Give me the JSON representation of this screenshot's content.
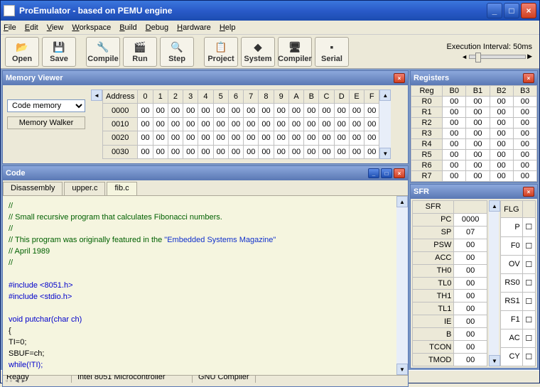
{
  "title": "ProEmulator - based on PEMU engine",
  "menu": [
    "File",
    "Edit",
    "View",
    "Workspace",
    "Build",
    "Debug",
    "Hardware",
    "Help"
  ],
  "toolbar": [
    {
      "label": "Open",
      "icon": "📂"
    },
    {
      "label": "Save",
      "icon": "💾"
    },
    {
      "label": "Compile",
      "icon": "🔧"
    },
    {
      "label": "Run",
      "icon": "🎬"
    },
    {
      "label": "Step",
      "icon": "🔍"
    },
    {
      "label": "Project",
      "icon": "📋"
    },
    {
      "label": "System",
      "icon": "◆"
    },
    {
      "label": "Compiler",
      "icon": "🖥"
    },
    {
      "label": "Serial",
      "icon": "▪"
    }
  ],
  "exec_interval_label": "Execution Interval: 50ms",
  "memory": {
    "title": "Memory Viewer",
    "dropdown": "Code memory",
    "walker_btn": "Memory Walker",
    "cols": [
      "Address",
      "0",
      "1",
      "2",
      "3",
      "4",
      "5",
      "6",
      "7",
      "8",
      "9",
      "A",
      "B",
      "C",
      "D",
      "E",
      "F"
    ],
    "rows": [
      [
        "0000",
        "00",
        "00",
        "00",
        "00",
        "00",
        "00",
        "00",
        "00",
        "00",
        "00",
        "00",
        "00",
        "00",
        "00",
        "00",
        "00"
      ],
      [
        "0010",
        "00",
        "00",
        "00",
        "00",
        "00",
        "00",
        "00",
        "00",
        "00",
        "00",
        "00",
        "00",
        "00",
        "00",
        "00",
        "00"
      ],
      [
        "0020",
        "00",
        "00",
        "00",
        "00",
        "00",
        "00",
        "00",
        "00",
        "00",
        "00",
        "00",
        "00",
        "00",
        "00",
        "00",
        "00"
      ],
      [
        "0030",
        "00",
        "00",
        "00",
        "00",
        "00",
        "00",
        "00",
        "00",
        "00",
        "00",
        "00",
        "00",
        "00",
        "00",
        "00",
        "00"
      ]
    ]
  },
  "code": {
    "title": "Code",
    "tabs": [
      "Disassembly",
      "upper.c",
      "fib.c"
    ],
    "active_tab": 2,
    "lines": [
      {
        "t": "//",
        "cls": "cm"
      },
      {
        "t": "//    Small recursive program that calculates Fibonacci numbers.",
        "cls": "cm"
      },
      {
        "t": "//",
        "cls": "cm"
      },
      {
        "t": "//    This program was originally featured in the \"Embedded Systems Magazine\"",
        "cls": "cm",
        "has_str": true
      },
      {
        "t": "//    April 1989",
        "cls": "cm"
      },
      {
        "t": "//",
        "cls": "cm"
      },
      {
        "t": "",
        "cls": ""
      },
      {
        "t": "#include <8051.h>",
        "cls": "kw"
      },
      {
        "t": "#include <stdio.h>",
        "cls": "kw"
      },
      {
        "t": "",
        "cls": ""
      },
      {
        "t": "void putchar(char ch)",
        "cls": "kw"
      },
      {
        "t": "{",
        "cls": ""
      },
      {
        "t": "      TI=0;",
        "cls": ""
      },
      {
        "t": "      SBUF=ch;",
        "cls": ""
      },
      {
        "t": "      while(!TI);",
        "cls": "kw"
      }
    ]
  },
  "registers": {
    "title": "Registers",
    "cols": [
      "Reg",
      "B0",
      "B1",
      "B2",
      "B3"
    ],
    "rows": [
      [
        "R0",
        "00",
        "00",
        "00",
        "00"
      ],
      [
        "R1",
        "00",
        "00",
        "00",
        "00"
      ],
      [
        "R2",
        "00",
        "00",
        "00",
        "00"
      ],
      [
        "R3",
        "00",
        "00",
        "00",
        "00"
      ],
      [
        "R4",
        "00",
        "00",
        "00",
        "00"
      ],
      [
        "R5",
        "00",
        "00",
        "00",
        "00"
      ],
      [
        "R6",
        "00",
        "00",
        "00",
        "00"
      ],
      [
        "R7",
        "00",
        "00",
        "00",
        "00"
      ]
    ]
  },
  "sfr": {
    "title": "SFR",
    "cols": [
      "SFR",
      ""
    ],
    "rows": [
      [
        "PC",
        "0000"
      ],
      [
        "SP",
        "07"
      ],
      [
        "PSW",
        "00"
      ],
      [
        "ACC",
        "00"
      ],
      [
        "TH0",
        "00"
      ],
      [
        "TL0",
        "00"
      ],
      [
        "TH1",
        "00"
      ],
      [
        "TL1",
        "00"
      ],
      [
        "IE",
        "00"
      ],
      [
        "B",
        "00"
      ],
      [
        "TCON",
        "00"
      ],
      [
        "TMOD",
        "00"
      ]
    ],
    "flg_cols": [
      "FLG",
      ""
    ],
    "flg_rows": [
      [
        "P"
      ],
      [
        "F0"
      ],
      [
        "OV"
      ],
      [
        "RS0"
      ],
      [
        "RS1"
      ],
      [
        "F1"
      ],
      [
        "AC"
      ],
      [
        "CY"
      ]
    ]
  },
  "status": {
    "ready": "Ready",
    "mcu": "Intel 8051 Microcontroller",
    "compiler": "GNU Compiler"
  }
}
